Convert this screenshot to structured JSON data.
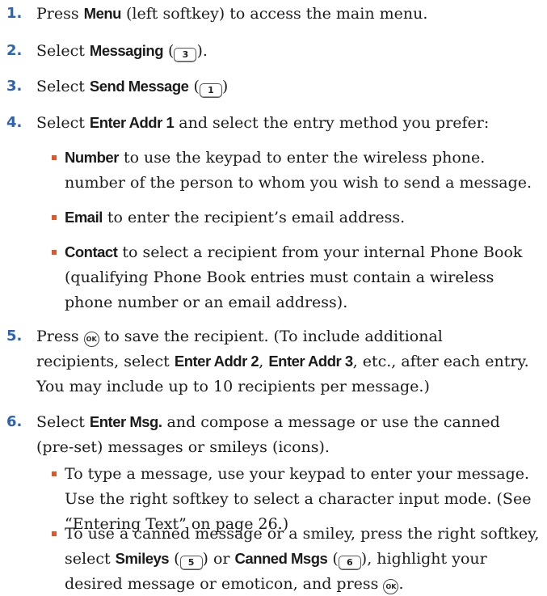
{
  "steps": [
    {
      "num": "1.",
      "lines": [
        [
          "Press ",
          {
            "b": "Menu"
          },
          " (left softkey) to access the main menu."
        ]
      ]
    },
    {
      "num": "2.",
      "lines": [
        [
          "Select ",
          {
            "b": "Messaging"
          },
          " (",
          {
            "key": "3"
          },
          ")."
        ]
      ]
    },
    {
      "num": "3.",
      "lines": [
        [
          "Select ",
          {
            "b": "Send Message"
          },
          " (",
          {
            "key": "1"
          },
          ")"
        ]
      ]
    },
    {
      "num": "4.",
      "lines": [
        [
          "Select ",
          {
            "b": "Enter Addr 1"
          },
          " and select the entry method you prefer:"
        ]
      ]
    },
    {
      "num": "5.",
      "lines": [
        [
          "Press ",
          {
            "ok": "OK"
          },
          " to save the recipient. (To include additional"
        ],
        [
          "recipients, select ",
          {
            "b": "Enter Addr 2"
          },
          ", ",
          {
            "b": "Enter Addr 3"
          },
          ", etc., after each entry."
        ],
        [
          "You may include up to 10 recipients per message.)"
        ]
      ]
    },
    {
      "num": "6.",
      "lines": [
        [
          "Select ",
          {
            "b": "Enter Msg."
          },
          " and compose a message or use the canned"
        ],
        [
          "(pre-set) messages or smileys (icons)."
        ]
      ]
    }
  ],
  "bullets_step4": [
    {
      "lines": [
        [
          {
            "b": "Number"
          },
          " to use the keypad to enter the wireless phone."
        ],
        [
          "number of the person to whom you wish to send a message."
        ]
      ]
    },
    {
      "lines": [
        [
          {
            "b": "Email"
          },
          " to enter the recipient’s email address."
        ]
      ]
    },
    {
      "lines": [
        [
          {
            "b": "Contact"
          },
          " to select a recipient from your internal Phone Book"
        ],
        [
          "(qualifying Phone Book entries must contain a wireless"
        ],
        [
          "phone number or an email address)."
        ]
      ]
    }
  ],
  "bullets_step6": [
    {
      "lines": [
        [
          "To type a message, use your keypad to enter your message."
        ],
        [
          "Use the right softkey to select a character input mode. (See"
        ],
        [
          "“Entering Text” on page 26.)"
        ]
      ]
    },
    {
      "lines": [
        [
          "To use a canned message or a smiley, press the right softkey,"
        ],
        [
          "select ",
          {
            "b": "Smileys"
          },
          " (",
          {
            "key": "5"
          },
          ") or ",
          {
            "b": "Canned Msgs"
          },
          " (",
          {
            "key": "6"
          },
          "), highlight your"
        ],
        [
          "desired message or emoticon, and press ",
          {
            "ok": "OK"
          },
          "."
        ]
      ]
    }
  ],
  "colors": {
    "step_number": "#2e63b0",
    "bullet": "#e0572a",
    "text": "#1b1b1b"
  },
  "icons": {
    "key": "keypad-key-icon",
    "ok": "ok-button-icon"
  }
}
